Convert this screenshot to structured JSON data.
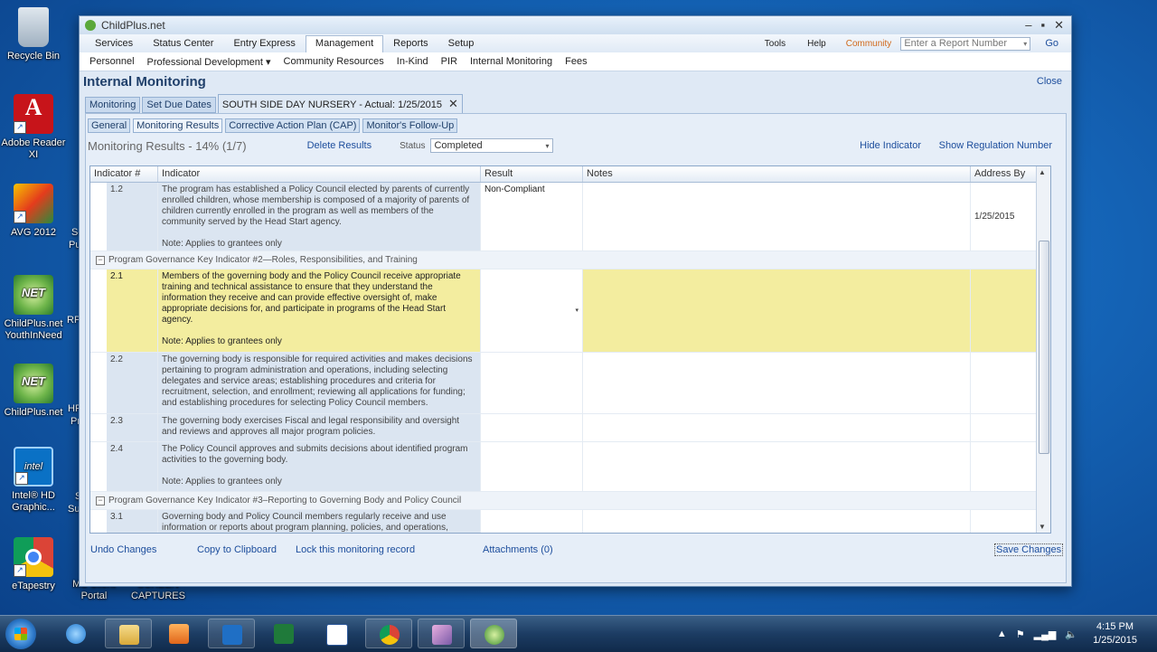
{
  "desktop": {
    "icons": [
      {
        "label": "Recycle Bin"
      },
      {
        "label": "Adobe Reader XI"
      },
      {
        "label": "AVG 2012"
      },
      {
        "label": "ChildPlus.net YouthInNeed"
      },
      {
        "label": "ChildPlus.net"
      },
      {
        "label": "Intel® HD Graphic..."
      },
      {
        "label": "eTapestry"
      },
      {
        "label": "MS Client Portal"
      },
      {
        "label": "SCREEN CAPTURES"
      }
    ],
    "partials": [
      "Sc",
      "Pu",
      "RP",
      "HP",
      "Pr",
      "S",
      "Su"
    ]
  },
  "window": {
    "title": "ChildPlus.net",
    "controls": {
      "minimize": "–",
      "maximize": "▪",
      "close": "✕"
    }
  },
  "menu": {
    "items": [
      "Services",
      "Status Center",
      "Entry Express",
      "Management",
      "Reports",
      "Setup"
    ],
    "active": "Management",
    "tools": "Tools",
    "help": "Help",
    "community": "Community",
    "report_placeholder": "Enter a Report Number",
    "go": "Go"
  },
  "submenu": {
    "items": [
      "Personnel",
      "Professional Development ▾",
      "Community Resources",
      "In-Kind",
      "PIR",
      "Internal Monitoring",
      "Fees"
    ]
  },
  "page": {
    "title": "Internal Monitoring",
    "close": "Close"
  },
  "doc_tabs": [
    "Monitoring",
    "Set Due Dates",
    "SOUTH SIDE DAY NURSERY - Actual: 1/25/2015"
  ],
  "sub_tabs": [
    "General",
    "Monitoring Results",
    "Corrective Action Plan (CAP)",
    "Monitor's Follow-Up"
  ],
  "results": {
    "title": "Monitoring Results - 14% (1/7)",
    "delete": "Delete Results",
    "status_label": "Status",
    "status_value": "Completed",
    "hide_indicator": "Hide Indicator",
    "show_regulation": "Show Regulation Number"
  },
  "grid": {
    "columns": [
      "Indicator #",
      "Indicator",
      "Result",
      "Notes",
      "Address By"
    ],
    "rows": [
      {
        "type": "row",
        "num": "1.2",
        "text": "The program has established a Policy Council elected by parents of currently enrolled children, whose membership is composed of a majority of parents of children currently enrolled in the program as well as members of the community served by the Head Start agency.",
        "note": "Note: Applies to grantees only",
        "result": "Non-Compliant",
        "address_by": "1/25/2015"
      },
      {
        "type": "group",
        "text": "Program Governance Key Indicator #2—Roles, Responsibilities, and Training"
      },
      {
        "type": "row",
        "num": "2.1",
        "text": "Members of the governing body and the Policy Council receive appropriate training and technical assistance to ensure that they understand the information they receive and can provide effective oversight of, make appropriate decisions for, and participate in programs of the Head Start agency.",
        "note": "Note: Applies to grantees only",
        "result": "",
        "address_by": ""
      },
      {
        "type": "row",
        "num": "2.2",
        "text": "The governing body is responsible for required activities and makes decisions pertaining to program administration and operations, including selecting delegates and service areas; establishing procedures and criteria for recruitment, selection, and enrollment; reviewing all applications for funding; and establishing procedures for selecting Policy Council members.",
        "note": "",
        "result": "",
        "address_by": ""
      },
      {
        "type": "row",
        "num": "2.3",
        "text": "The governing body exercises Fiscal and legal responsibility and oversight and reviews and approves all major program policies.",
        "note": "",
        "result": "",
        "address_by": ""
      },
      {
        "type": "row",
        "num": "2.4",
        "text": "The Policy Council approves and submits decisions about identified program activities to the governing body.",
        "note": "Note: Applies to grantees only",
        "result": "",
        "address_by": ""
      },
      {
        "type": "group",
        "text": "Program Governance Key Indicator #3–Reporting to Governing Body and Policy Council"
      },
      {
        "type": "row",
        "num": "3.1",
        "text": "Governing body and Policy Council members regularly receive and use information or reports about program planning, policies, and operations,",
        "note": "",
        "result": "",
        "address_by": ""
      }
    ]
  },
  "footer": {
    "undo": "Undo Changes",
    "copy": "Copy to Clipboard",
    "lock": "Lock this monitoring record",
    "attachments": "Attachments (0)",
    "save": "Save Changes"
  },
  "taskbar": {
    "time": "4:15 PM",
    "date": "1/25/2015"
  }
}
